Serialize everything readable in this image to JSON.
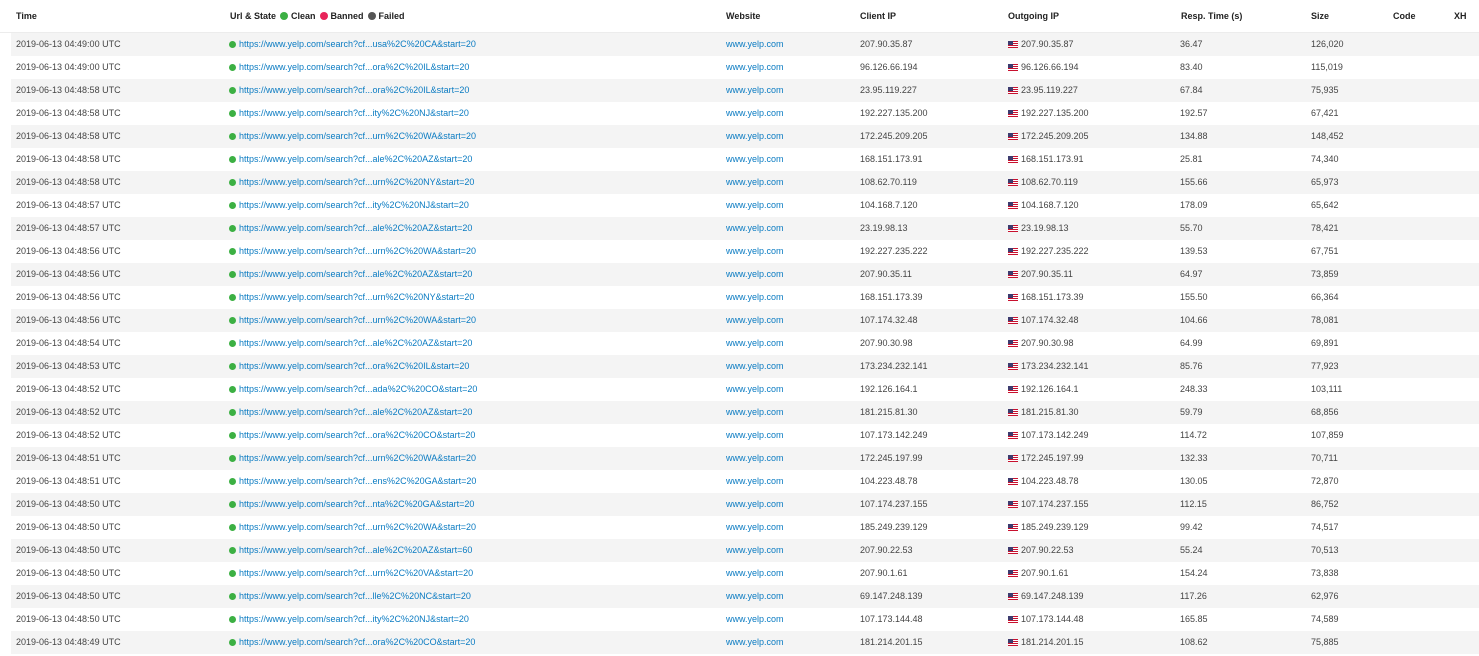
{
  "headers": {
    "time": "Time",
    "url_state": "Url & State",
    "legend": [
      {
        "label": "Clean",
        "color": "#3cb043"
      },
      {
        "label": "Banned",
        "color": "#e8245a"
      },
      {
        "label": "Failed",
        "color": "#555555"
      }
    ],
    "website": "Website",
    "client_ip": "Client IP",
    "outgoing_ip": "Outgoing IP",
    "resp_time": "Resp. Time (s)",
    "size": "Size",
    "code": "Code",
    "xh": "XH"
  },
  "rows": [
    {
      "time": "2019-06-13 04:49:00 UTC",
      "url": "https://www.yelp.com/search?cf...usa%2C%20CA&start=20",
      "website": "www.yelp.com",
      "client_ip": "207.90.35.87",
      "outgoing_ip": "207.90.35.87",
      "resp": "36.47",
      "size": "126,020",
      "state": "clean"
    },
    {
      "time": "2019-06-13 04:49:00 UTC",
      "url": "https://www.yelp.com/search?cf...ora%2C%20IL&start=20",
      "website": "www.yelp.com",
      "client_ip": "96.126.66.194",
      "outgoing_ip": "96.126.66.194",
      "resp": "83.40",
      "size": "115,019",
      "state": "clean"
    },
    {
      "time": "2019-06-13 04:48:58 UTC",
      "url": "https://www.yelp.com/search?cf...ora%2C%20IL&start=20",
      "website": "www.yelp.com",
      "client_ip": "23.95.119.227",
      "outgoing_ip": "23.95.119.227",
      "resp": "67.84",
      "size": "75,935",
      "state": "clean"
    },
    {
      "time": "2019-06-13 04:48:58 UTC",
      "url": "https://www.yelp.com/search?cf...ity%2C%20NJ&start=20",
      "website": "www.yelp.com",
      "client_ip": "192.227.135.200",
      "outgoing_ip": "192.227.135.200",
      "resp": "192.57",
      "size": "67,421",
      "state": "clean"
    },
    {
      "time": "2019-06-13 04:48:58 UTC",
      "url": "https://www.yelp.com/search?cf...urn%2C%20WA&start=20",
      "website": "www.yelp.com",
      "client_ip": "172.245.209.205",
      "outgoing_ip": "172.245.209.205",
      "resp": "134.88",
      "size": "148,452",
      "state": "clean"
    },
    {
      "time": "2019-06-13 04:48:58 UTC",
      "url": "https://www.yelp.com/search?cf...ale%2C%20AZ&start=20",
      "website": "www.yelp.com",
      "client_ip": "168.151.173.91",
      "outgoing_ip": "168.151.173.91",
      "resp": "25.81",
      "size": "74,340",
      "state": "clean"
    },
    {
      "time": "2019-06-13 04:48:58 UTC",
      "url": "https://www.yelp.com/search?cf...urn%2C%20NY&start=20",
      "website": "www.yelp.com",
      "client_ip": "108.62.70.119",
      "outgoing_ip": "108.62.70.119",
      "resp": "155.66",
      "size": "65,973",
      "state": "clean"
    },
    {
      "time": "2019-06-13 04:48:57 UTC",
      "url": "https://www.yelp.com/search?cf...ity%2C%20NJ&start=20",
      "website": "www.yelp.com",
      "client_ip": "104.168.7.120",
      "outgoing_ip": "104.168.7.120",
      "resp": "178.09",
      "size": "65,642",
      "state": "clean"
    },
    {
      "time": "2019-06-13 04:48:57 UTC",
      "url": "https://www.yelp.com/search?cf...ale%2C%20AZ&start=20",
      "website": "www.yelp.com",
      "client_ip": "23.19.98.13",
      "outgoing_ip": "23.19.98.13",
      "resp": "55.70",
      "size": "78,421",
      "state": "clean"
    },
    {
      "time": "2019-06-13 04:48:56 UTC",
      "url": "https://www.yelp.com/search?cf...urn%2C%20WA&start=20",
      "website": "www.yelp.com",
      "client_ip": "192.227.235.222",
      "outgoing_ip": "192.227.235.222",
      "resp": "139.53",
      "size": "67,751",
      "state": "clean"
    },
    {
      "time": "2019-06-13 04:48:56 UTC",
      "url": "https://www.yelp.com/search?cf...ale%2C%20AZ&start=20",
      "website": "www.yelp.com",
      "client_ip": "207.90.35.11",
      "outgoing_ip": "207.90.35.11",
      "resp": "64.97",
      "size": "73,859",
      "state": "clean"
    },
    {
      "time": "2019-06-13 04:48:56 UTC",
      "url": "https://www.yelp.com/search?cf...urn%2C%20NY&start=20",
      "website": "www.yelp.com",
      "client_ip": "168.151.173.39",
      "outgoing_ip": "168.151.173.39",
      "resp": "155.50",
      "size": "66,364",
      "state": "clean"
    },
    {
      "time": "2019-06-13 04:48:56 UTC",
      "url": "https://www.yelp.com/search?cf...urn%2C%20WA&start=20",
      "website": "www.yelp.com",
      "client_ip": "107.174.32.48",
      "outgoing_ip": "107.174.32.48",
      "resp": "104.66",
      "size": "78,081",
      "state": "clean"
    },
    {
      "time": "2019-06-13 04:48:54 UTC",
      "url": "https://www.yelp.com/search?cf...ale%2C%20AZ&start=20",
      "website": "www.yelp.com",
      "client_ip": "207.90.30.98",
      "outgoing_ip": "207.90.30.98",
      "resp": "64.99",
      "size": "69,891",
      "state": "clean"
    },
    {
      "time": "2019-06-13 04:48:53 UTC",
      "url": "https://www.yelp.com/search?cf...ora%2C%20IL&start=20",
      "website": "www.yelp.com",
      "client_ip": "173.234.232.141",
      "outgoing_ip": "173.234.232.141",
      "resp": "85.76",
      "size": "77,923",
      "state": "clean"
    },
    {
      "time": "2019-06-13 04:48:52 UTC",
      "url": "https://www.yelp.com/search?cf...ada%2C%20CO&start=20",
      "website": "www.yelp.com",
      "client_ip": "192.126.164.1",
      "outgoing_ip": "192.126.164.1",
      "resp": "248.33",
      "size": "103,111",
      "state": "clean"
    },
    {
      "time": "2019-06-13 04:48:52 UTC",
      "url": "https://www.yelp.com/search?cf...ale%2C%20AZ&start=20",
      "website": "www.yelp.com",
      "client_ip": "181.215.81.30",
      "outgoing_ip": "181.215.81.30",
      "resp": "59.79",
      "size": "68,856",
      "state": "clean"
    },
    {
      "time": "2019-06-13 04:48:52 UTC",
      "url": "https://www.yelp.com/search?cf...ora%2C%20CO&start=20",
      "website": "www.yelp.com",
      "client_ip": "107.173.142.249",
      "outgoing_ip": "107.173.142.249",
      "resp": "114.72",
      "size": "107,859",
      "state": "clean"
    },
    {
      "time": "2019-06-13 04:48:51 UTC",
      "url": "https://www.yelp.com/search?cf...urn%2C%20WA&start=20",
      "website": "www.yelp.com",
      "client_ip": "172.245.197.99",
      "outgoing_ip": "172.245.197.99",
      "resp": "132.33",
      "size": "70,711",
      "state": "clean"
    },
    {
      "time": "2019-06-13 04:48:51 UTC",
      "url": "https://www.yelp.com/search?cf...ens%2C%20GA&start=20",
      "website": "www.yelp.com",
      "client_ip": "104.223.48.78",
      "outgoing_ip": "104.223.48.78",
      "resp": "130.05",
      "size": "72,870",
      "state": "clean"
    },
    {
      "time": "2019-06-13 04:48:50 UTC",
      "url": "https://www.yelp.com/search?cf...nta%2C%20GA&start=20",
      "website": "www.yelp.com",
      "client_ip": "107.174.237.155",
      "outgoing_ip": "107.174.237.155",
      "resp": "112.15",
      "size": "86,752",
      "state": "clean"
    },
    {
      "time": "2019-06-13 04:48:50 UTC",
      "url": "https://www.yelp.com/search?cf...urn%2C%20WA&start=20",
      "website": "www.yelp.com",
      "client_ip": "185.249.239.129",
      "outgoing_ip": "185.249.239.129",
      "resp": "99.42",
      "size": "74,517",
      "state": "clean"
    },
    {
      "time": "2019-06-13 04:48:50 UTC",
      "url": "https://www.yelp.com/search?cf...ale%2C%20AZ&start=60",
      "website": "www.yelp.com",
      "client_ip": "207.90.22.53",
      "outgoing_ip": "207.90.22.53",
      "resp": "55.24",
      "size": "70,513",
      "state": "clean"
    },
    {
      "time": "2019-06-13 04:48:50 UTC",
      "url": "https://www.yelp.com/search?cf...urn%2C%20VA&start=20",
      "website": "www.yelp.com",
      "client_ip": "207.90.1.61",
      "outgoing_ip": "207.90.1.61",
      "resp": "154.24",
      "size": "73,838",
      "state": "clean"
    },
    {
      "time": "2019-06-13 04:48:50 UTC",
      "url": "https://www.yelp.com/search?cf...lle%2C%20NC&start=20",
      "website": "www.yelp.com",
      "client_ip": "69.147.248.139",
      "outgoing_ip": "69.147.248.139",
      "resp": "117.26",
      "size": "62,976",
      "state": "clean"
    },
    {
      "time": "2019-06-13 04:48:50 UTC",
      "url": "https://www.yelp.com/search?cf...ity%2C%20NJ&start=20",
      "website": "www.yelp.com",
      "client_ip": "107.173.144.48",
      "outgoing_ip": "107.173.144.48",
      "resp": "165.85",
      "size": "74,589",
      "state": "clean"
    },
    {
      "time": "2019-06-13 04:48:49 UTC",
      "url": "https://www.yelp.com/search?cf...ora%2C%20CO&start=20",
      "website": "www.yelp.com",
      "client_ip": "181.214.201.15",
      "outgoing_ip": "181.214.201.15",
      "resp": "108.62",
      "size": "75,885",
      "state": "clean"
    }
  ]
}
